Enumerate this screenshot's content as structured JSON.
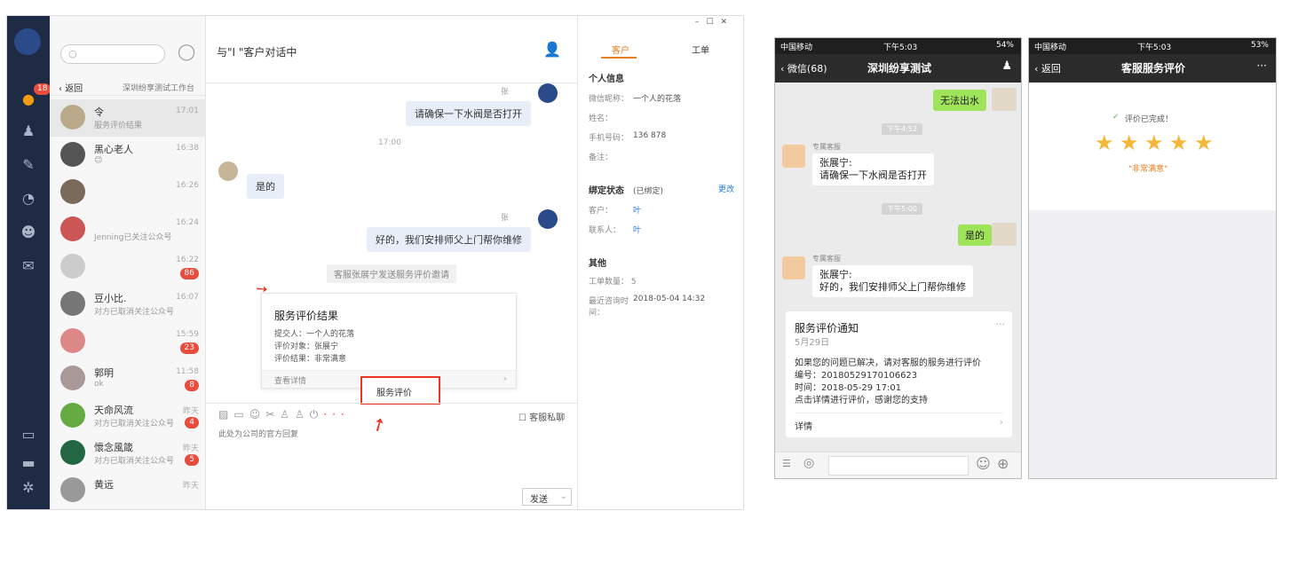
{
  "window_controls": {
    "min": "–",
    "max": "☐",
    "close": "✕"
  },
  "rail": {
    "badge": "18"
  },
  "list": {
    "back": "返回",
    "workbench": "深圳纷享测试工作台",
    "items": [
      {
        "name": "令",
        "sub": "服务评价结果",
        "time": "17:01",
        "count": ""
      },
      {
        "name": "黑心老人",
        "sub": "😊",
        "time": "16:38",
        "count": ""
      },
      {
        "name": "",
        "sub": "",
        "time": "16:26",
        "count": ""
      },
      {
        "name": "",
        "sub": "Jenning已关注公众号",
        "time": "16:24",
        "count": ""
      },
      {
        "name": "",
        "sub": "",
        "time": "16:22",
        "count": "86"
      },
      {
        "name": "豆小比.",
        "sub": "对方已取消关注公众号",
        "time": "16:07",
        "count": ""
      },
      {
        "name": "",
        "sub": "",
        "time": "15:59",
        "count": "23"
      },
      {
        "name": "郭明",
        "sub": "ok",
        "time": "11:58",
        "count": "8"
      },
      {
        "name": "天命风流",
        "sub": "对方已取消关注公众号",
        "time": "昨天",
        "count": "4"
      },
      {
        "name": "懷念風箴",
        "sub": "对方已取消关注公众号",
        "time": "昨天",
        "count": "5"
      },
      {
        "name": "黄远",
        "sub": "",
        "time": "昨天",
        "count": ""
      }
    ]
  },
  "chat": {
    "title": "与\"I      \"客户对话中",
    "agent_name1": "张",
    "msg1": "请确保一下水阀是否打开",
    "time1": "17:00",
    "msg2": "是的",
    "agent_name2": "张",
    "msg3": "好的，我们安排师父上门帮你维修",
    "system": "客服张展宁发送服务评价邀请",
    "card": {
      "title": "服务评价结果",
      "submitter": "提交人：一个人的花落",
      "target": "评价对象：张展宁",
      "result": "评价结果：非常满意",
      "link": "查看详情"
    },
    "popup": "服务评价",
    "private": "客服私聊",
    "reply_placeholder": "此处为公司的官方回复",
    "send": "发送"
  },
  "right": {
    "tab_customer": "客户",
    "tab_ticket": "工单",
    "personal": "个人信息",
    "wechat_label": "微信昵称：",
    "wechat_value": "一个人的花落",
    "name_label": "姓名：",
    "phone_label": "手机号码：",
    "phone_value": "136       878",
    "remark_label": "备注：",
    "bind_label": "绑定状态",
    "bind_value": "(已绑定)",
    "bind_change": "更改",
    "cust_label": "客户：",
    "cust_value": "叶",
    "contact_label": "联系人：",
    "contact_value": "叶",
    "other": "其他",
    "ticket_count": "工单数量： 5",
    "recent_label": "最近咨询时间：",
    "recent_value": "2018-05-04 14:32"
  },
  "phone1": {
    "carrier": "中国移动",
    "time": "下午5:03",
    "battery": "54%",
    "back": "微信(68)",
    "title": "深圳纷享测试",
    "msg1": "无法出水",
    "ts1": "下午4:52",
    "agent": "专属客服",
    "msg2a": "张展宁:",
    "msg2b": "请确保一下水阀是否打开",
    "ts2": "下午5:00",
    "msg3": "是的",
    "msg4a": "张展宁:",
    "msg4b": "好的，我们安排师父上门帮你维修",
    "card": {
      "title": "服务评价通知",
      "date": "5月29日",
      "l1": "如果您的问题已解决，请对客服的服务进行评价",
      "l2": "编号：20180529170106623",
      "l3": "时间：2018-05-29 17:01",
      "l4": "点击详情进行评价，感谢您的支持",
      "detail": "详情"
    }
  },
  "phone2": {
    "carrier": "中国移动",
    "time": "下午5:03",
    "battery": "53%",
    "back": "返回",
    "title": "客服服务评价",
    "done": "评价已完成！",
    "rating_text": "\"非常满意\"",
    "rating": 5
  }
}
